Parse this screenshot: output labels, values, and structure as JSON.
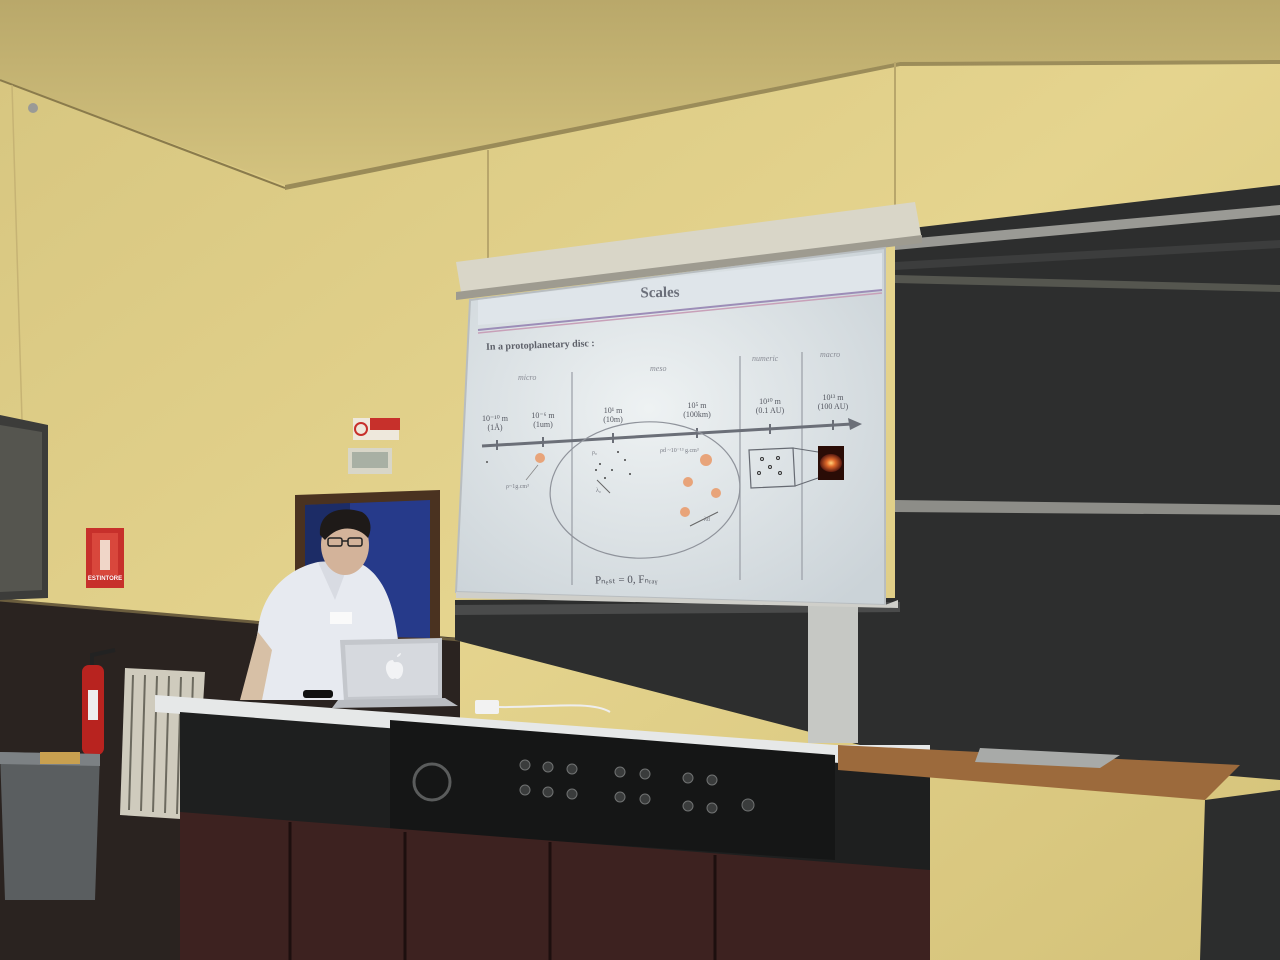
{
  "slide": {
    "title": "Scales",
    "subtitle": "In a protoplanetary disc :",
    "regions": [
      "micro",
      "meso",
      "numeric",
      "macro"
    ],
    "scales": [
      {
        "value": "10⁻¹⁰ m",
        "unit": "(1Å)"
      },
      {
        "value": "10⁻⁶ m",
        "unit": "(1um)"
      },
      {
        "value": "10¹ m",
        "unit": "(10m)"
      },
      {
        "value": "10⁵ m",
        "unit": "(100km)"
      },
      {
        "value": "10¹⁰ m",
        "unit": "(0.1 AU)"
      },
      {
        "value": "10¹³ m",
        "unit": "(100 AU)"
      }
    ],
    "notes": {
      "rho_small": "ρ~1g.cm³",
      "rho_d": "ρ₀",
      "lambda_g": "λ₀",
      "rho_dust": "ρd ~10⁻¹³ g.cm³",
      "lambda_d": "λd"
    },
    "footer": "Pₙₑₛₜ = 0, Fₙᵣₐᵧ"
  },
  "room": {
    "exit_sign": "ESTINTORE",
    "laptop_logo": "apple-logo"
  },
  "colors": {
    "wall": "#e1cf86",
    "ceiling": "#d0bf7e",
    "blackboard": "#2c2d2d",
    "screen": "#dde3e6",
    "desk": "#e8eaea",
    "console": "#1c1d1d",
    "particle": "#e8a47a"
  }
}
